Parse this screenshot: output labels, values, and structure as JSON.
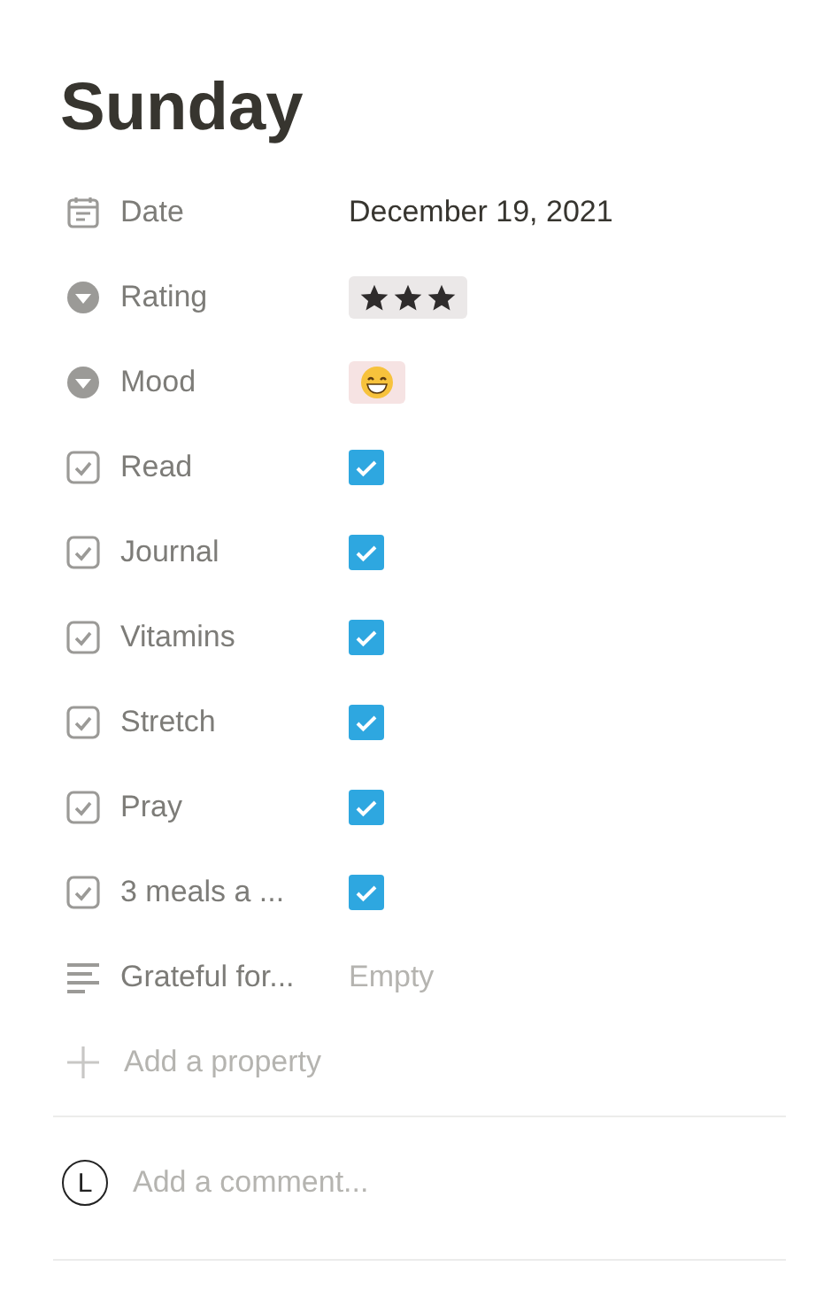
{
  "title": "Sunday",
  "properties": [
    {
      "kind": "date",
      "label": "Date",
      "value": "December 19, 2021"
    },
    {
      "kind": "rating",
      "label": "Rating",
      "stars": 3,
      "color": "#ebe8e8"
    },
    {
      "kind": "mood",
      "label": "Mood",
      "color": "#f6e3e3"
    },
    {
      "kind": "checkbox",
      "label": "Read",
      "checked": true
    },
    {
      "kind": "checkbox",
      "label": "Journal",
      "checked": true
    },
    {
      "kind": "checkbox",
      "label": "Vitamins",
      "checked": true
    },
    {
      "kind": "checkbox",
      "label": "Stretch",
      "checked": true
    },
    {
      "kind": "checkbox",
      "label": "Pray",
      "checked": true
    },
    {
      "kind": "checkbox",
      "label": "3 meals a ...",
      "checked": true
    },
    {
      "kind": "text",
      "label": "Grateful for...",
      "placeholder": "Empty"
    }
  ],
  "add_property": "Add a property",
  "comment": {
    "avatar": "L",
    "placeholder": "Add a comment..."
  }
}
